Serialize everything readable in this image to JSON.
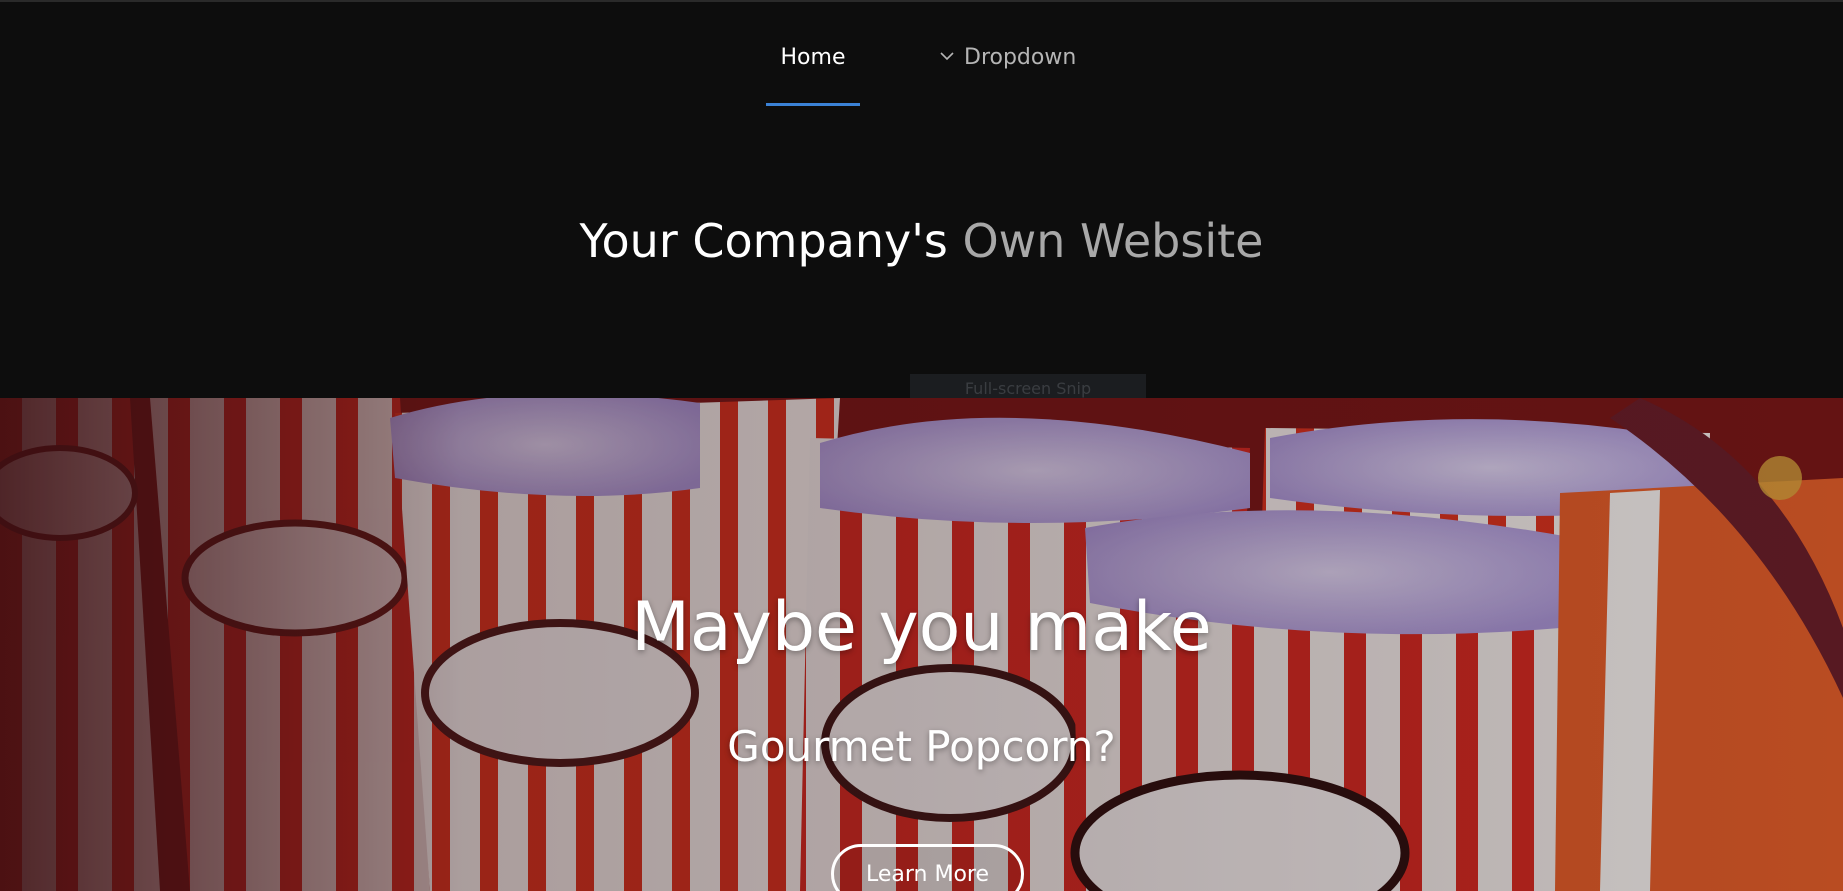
{
  "nav": {
    "items": [
      {
        "label": "Home",
        "active": true
      },
      {
        "label": "Dropdown",
        "icon": "chevron-down-icon"
      }
    ],
    "active_color": "#3b82d6"
  },
  "hero": {
    "title_strong": "Your Company's",
    "title_light": "Own Website"
  },
  "overlay": {
    "snip_label": "Full-screen Snip"
  },
  "banner": {
    "image": "popcorn-boxes-photo",
    "heading": "Maybe you make",
    "subheading": "Gourmet Popcorn?",
    "button_label": "Learn More"
  }
}
